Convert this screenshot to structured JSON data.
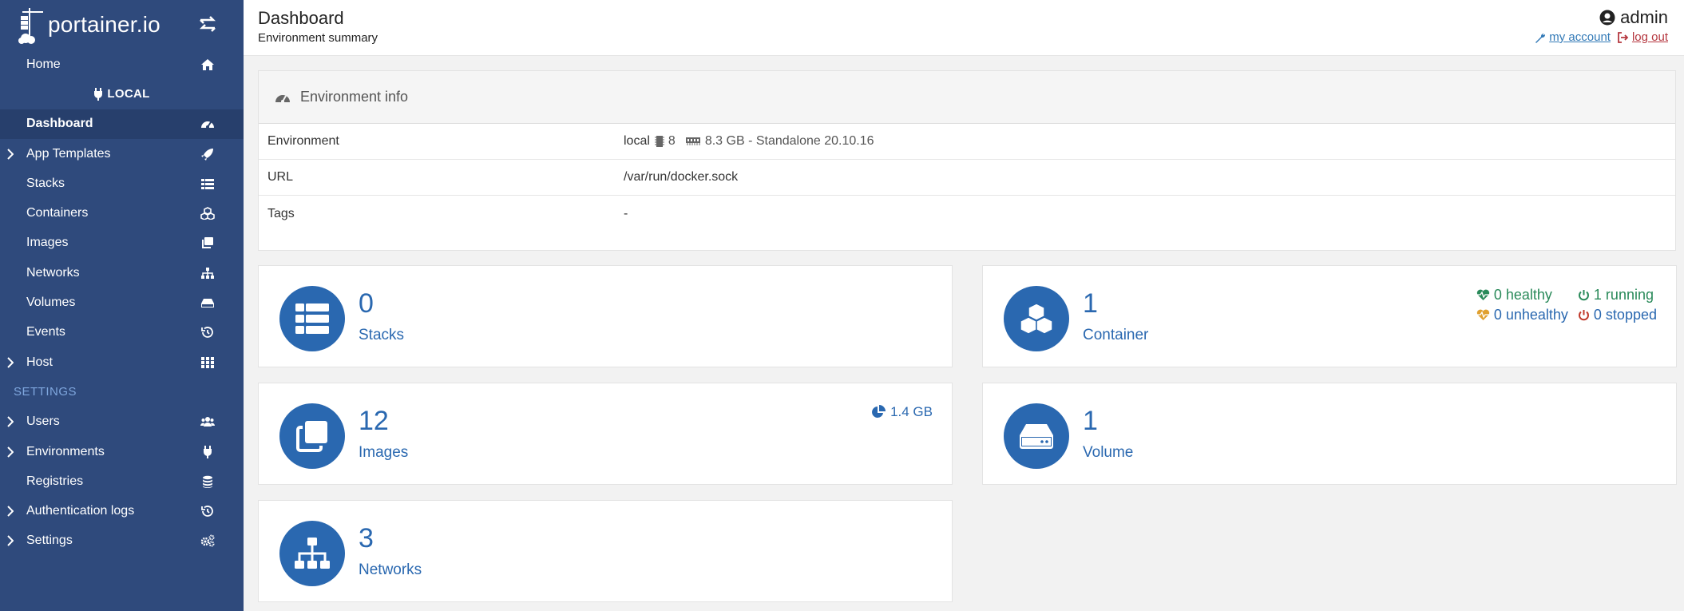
{
  "sidebar": {
    "brand": "portainer.io",
    "home": "Home",
    "environment_name": "LOCAL",
    "items": [
      {
        "label": "Dashboard",
        "icon": "dashboard-icon"
      },
      {
        "label": "App Templates",
        "icon": "rocket-icon"
      },
      {
        "label": "Stacks",
        "icon": "list-icon"
      },
      {
        "label": "Containers",
        "icon": "cubes-icon"
      },
      {
        "label": "Images",
        "icon": "clone-icon"
      },
      {
        "label": "Networks",
        "icon": "sitemap-icon"
      },
      {
        "label": "Volumes",
        "icon": "hdd-icon"
      },
      {
        "label": "Events",
        "icon": "history-icon"
      },
      {
        "label": "Host",
        "icon": "th-icon"
      }
    ],
    "settings_title": "SETTINGS",
    "settings_items": [
      {
        "label": "Users",
        "icon": "users-icon"
      },
      {
        "label": "Environments",
        "icon": "plug-icon"
      },
      {
        "label": "Registries",
        "icon": "database-icon"
      },
      {
        "label": "Authentication logs",
        "icon": "history-icon"
      },
      {
        "label": "Settings",
        "icon": "cogs-icon"
      }
    ]
  },
  "header": {
    "title": "Dashboard",
    "subtitle": "Environment summary",
    "username": "admin",
    "my_account": "my account",
    "log_out": "log out"
  },
  "env_info": {
    "title": "Environment info",
    "rows": [
      {
        "key": "Environment",
        "name": "local",
        "cpu": "8",
        "memory": "8.3 GB - Standalone 20.10.16"
      },
      {
        "key": "URL",
        "value": "/var/run/docker.sock"
      },
      {
        "key": "Tags",
        "value": "-"
      }
    ]
  },
  "tiles": {
    "stacks": {
      "count": "0",
      "label": "Stacks"
    },
    "containers": {
      "count": "1",
      "label": "Container",
      "healthy": "0 healthy",
      "unhealthy": "0 unhealthy",
      "running": "1 running",
      "stopped": "0 stopped"
    },
    "images": {
      "count": "12",
      "label": "Images",
      "size": "1.4 GB"
    },
    "volumes": {
      "count": "1",
      "label": "Volume"
    },
    "networks": {
      "count": "3",
      "label": "Networks"
    }
  },
  "colors": {
    "sidebar": "#2f4a7c",
    "accent": "#2a68b0",
    "healthy": "#2a8a5a",
    "unhealthy": "#e0a030",
    "stopped": "#c0392b",
    "logout": "#b5373f"
  }
}
